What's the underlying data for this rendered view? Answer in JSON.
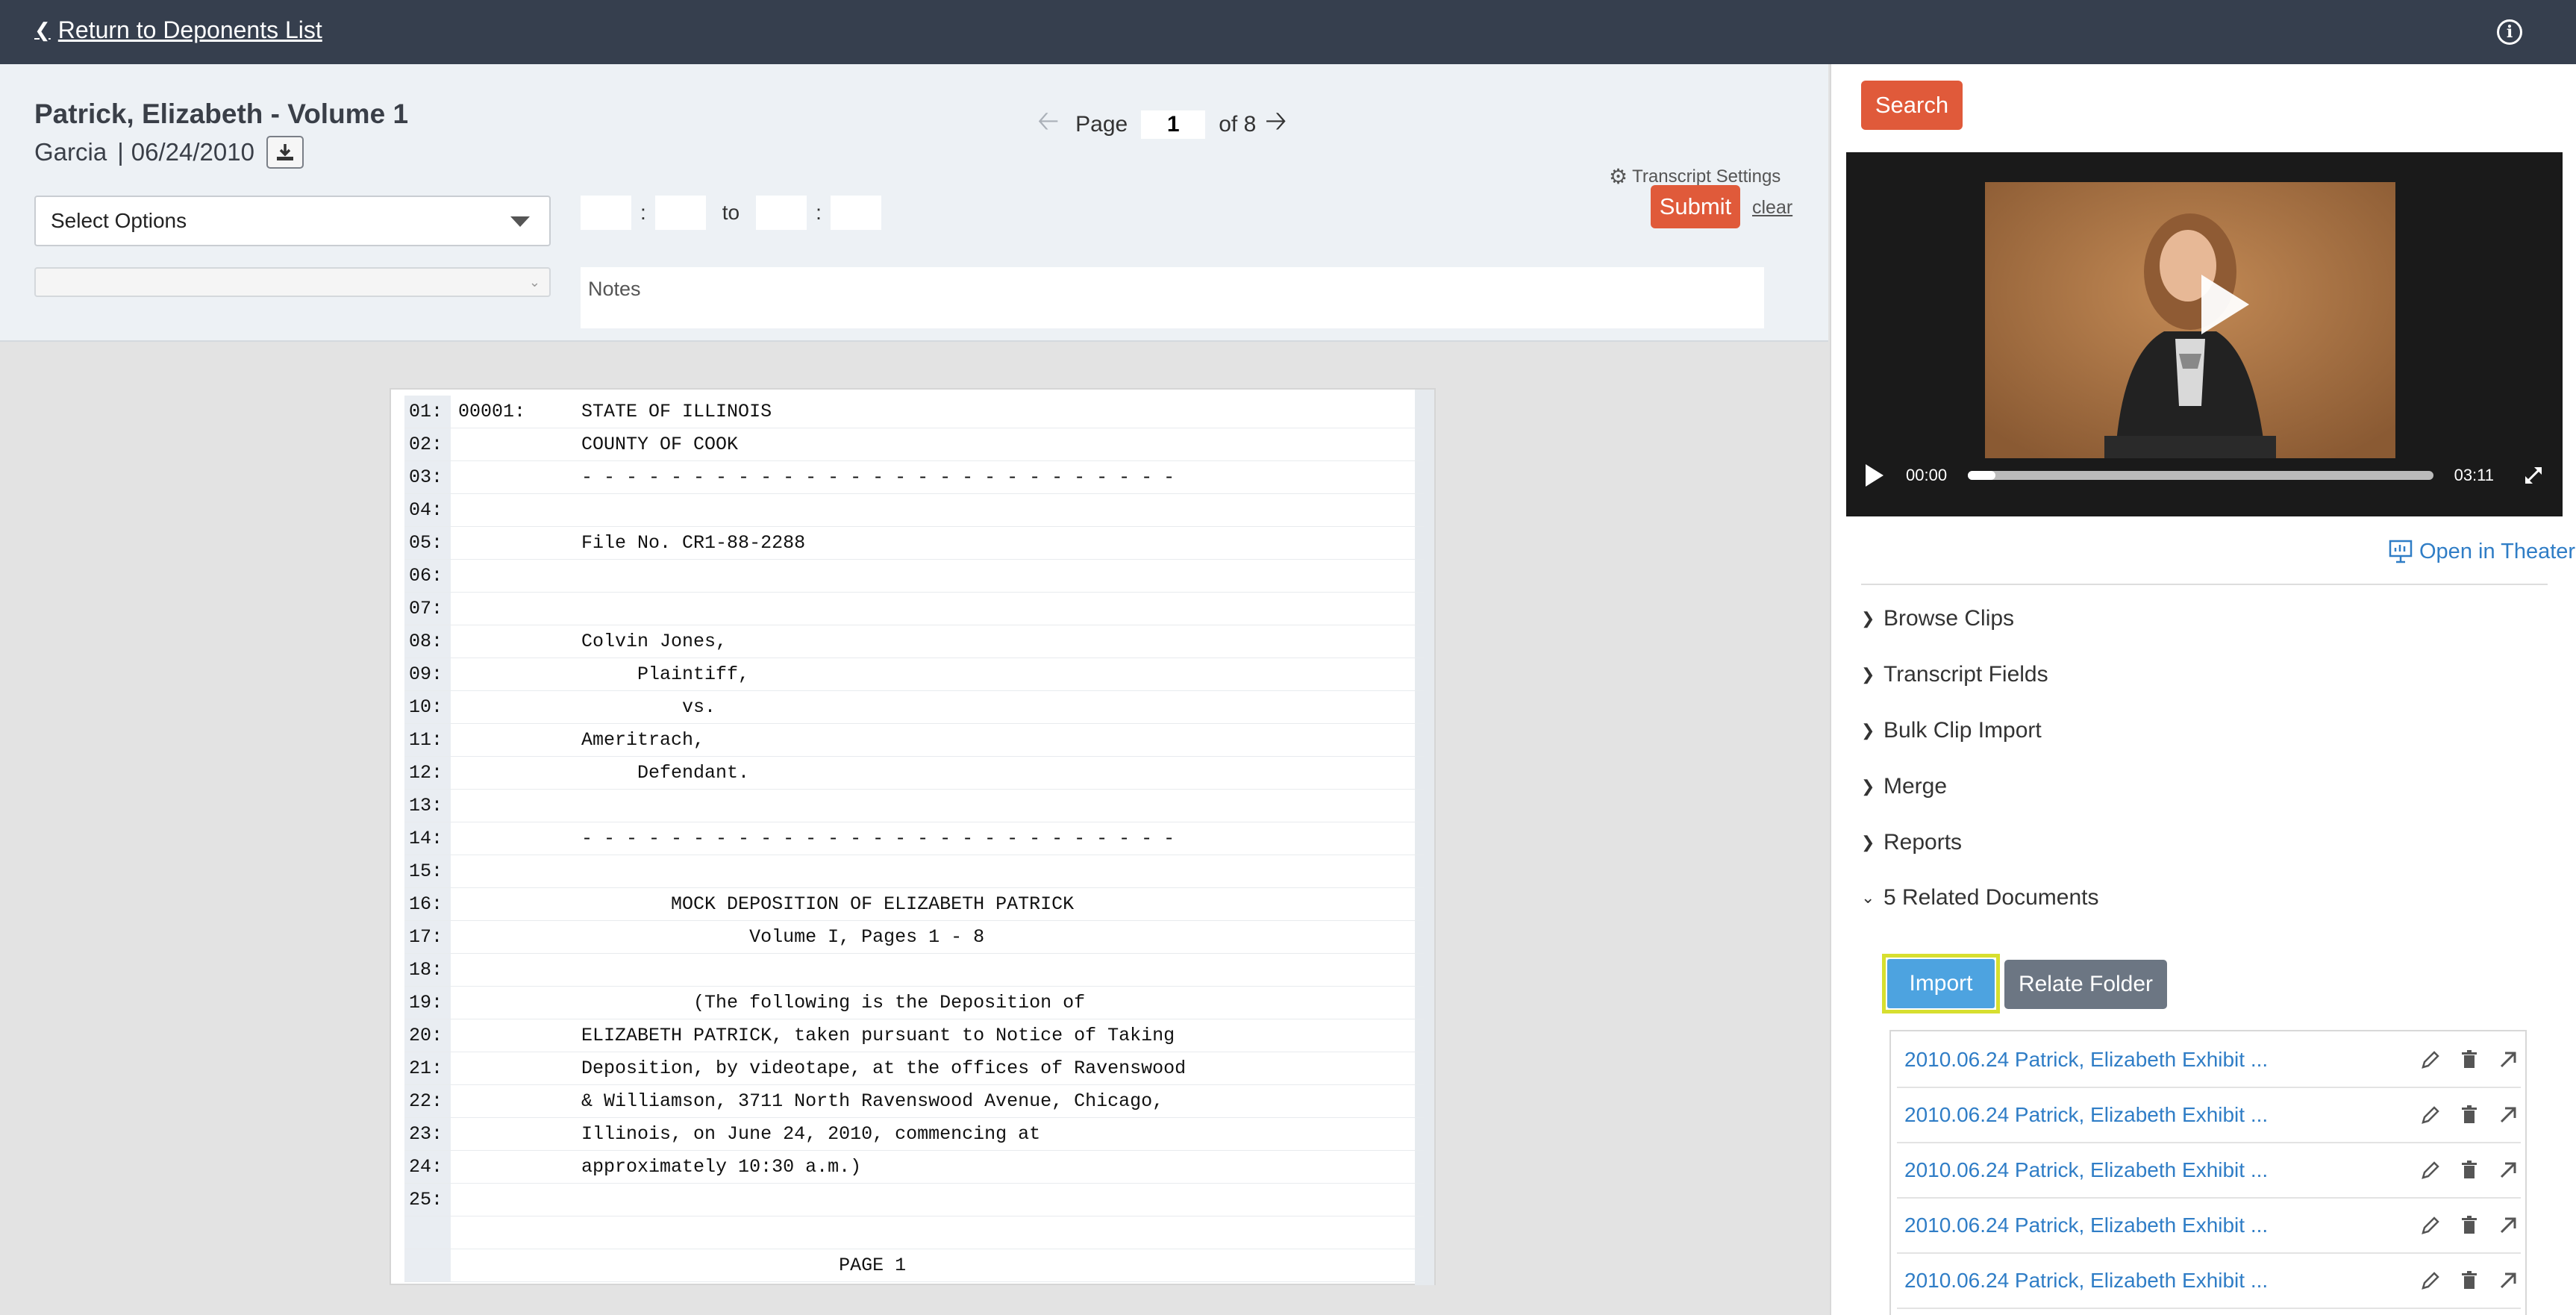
{
  "topbar": {
    "back_label": "Return to Deponents List"
  },
  "header": {
    "title": "Patrick, Elizabeth - Volume 1",
    "witness": "Garcia",
    "separator": "|",
    "date": "06/24/2010",
    "page_label": "Page",
    "page_value": "1",
    "page_total": "of 8",
    "settings_label": "Transcript Settings",
    "select_options": "Select Options",
    "to_label": "to",
    "colon": ":",
    "submit_label": "Submit",
    "clear_label": "clear",
    "notes_placeholder": "Notes"
  },
  "transcript": {
    "lines": [
      {
        "num": "01:",
        "text": "00001:     STATE OF ILLINOIS"
      },
      {
        "num": "02:",
        "text": "           COUNTY OF COOK"
      },
      {
        "num": "03:",
        "text": "           - - - - - - - - - - - - - - - - - - - - - - - - - - -"
      },
      {
        "num": "04:",
        "text": ""
      },
      {
        "num": "05:",
        "text": "           File No. CR1-88-2288"
      },
      {
        "num": "06:",
        "text": ""
      },
      {
        "num": "07:",
        "text": ""
      },
      {
        "num": "08:",
        "text": "           Colvin Jones,"
      },
      {
        "num": "09:",
        "text": "                Plaintiff,"
      },
      {
        "num": "10:",
        "text": "                    vs."
      },
      {
        "num": "11:",
        "text": "           Ameritrach,"
      },
      {
        "num": "12:",
        "text": "                Defendant."
      },
      {
        "num": "13:",
        "text": ""
      },
      {
        "num": "14:",
        "text": "           - - - - - - - - - - - - - - - - - - - - - - - - - - -"
      },
      {
        "num": "15:",
        "text": ""
      },
      {
        "num": "16:",
        "text": "                   MOCK DEPOSITION OF ELIZABETH PATRICK"
      },
      {
        "num": "17:",
        "text": "                          Volume I, Pages 1 - 8"
      },
      {
        "num": "18:",
        "text": ""
      },
      {
        "num": "19:",
        "text": "                     (The following is the Deposition of"
      },
      {
        "num": "20:",
        "text": "           ELIZABETH PATRICK, taken pursuant to Notice of Taking"
      },
      {
        "num": "21:",
        "text": "           Deposition, by videotape, at the offices of Ravenswood"
      },
      {
        "num": "22:",
        "text": "           & Williamson, 3711 North Ravenswood Avenue, Chicago,"
      },
      {
        "num": "23:",
        "text": "           Illinois, on June 24, 2010, commencing at"
      },
      {
        "num": "24:",
        "text": "           approximately 10:30 a.m.)"
      },
      {
        "num": "25:",
        "text": ""
      },
      {
        "num": "",
        "text": ""
      },
      {
        "num": "",
        "text": "                                  PAGE 1"
      }
    ]
  },
  "right": {
    "search_label": "Search",
    "video": {
      "current_time": "00:00",
      "duration": "03:11",
      "progress": 0.06
    },
    "theater_label": "Open in Theater",
    "sections": [
      "Browse Clips",
      "Transcript Fields",
      "Bulk Clip Import",
      "Merge",
      "Reports"
    ],
    "related_label": "5 Related Documents",
    "import_label": "Import",
    "relate_label": "Relate Folder",
    "documents": [
      "2010.06.24 Patrick, Elizabeth Exhibit ...",
      "2010.06.24 Patrick, Elizabeth Exhibit ...",
      "2010.06.24 Patrick, Elizabeth Exhibit ...",
      "2010.06.24 Patrick, Elizabeth Exhibit ...",
      "2010.06.24 Patrick, Elizabeth Exhibit ..."
    ]
  },
  "colors": {
    "topbar": "#363f4e",
    "accent": "#e05a3a",
    "link": "#2f7dc6",
    "import": "#4da3e0",
    "highlight": "#d7df2f"
  }
}
